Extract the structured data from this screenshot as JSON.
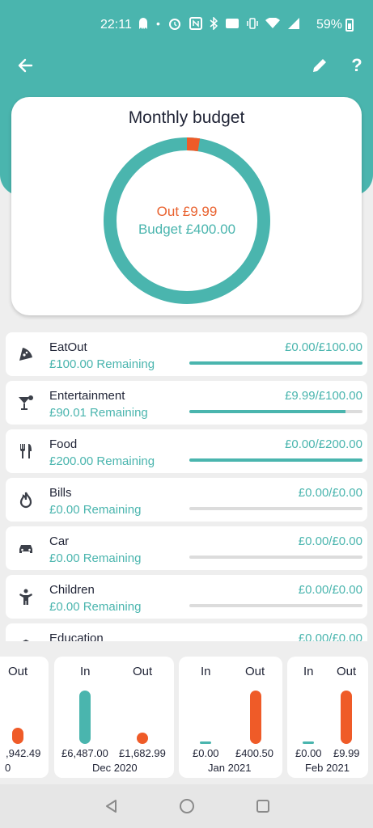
{
  "status_bar": {
    "time": "22:11",
    "dot": "•",
    "battery": "59%",
    "icons": [
      "ghost-icon",
      "alarm-icon",
      "nfc-icon",
      "bluetooth-icon",
      "volte-icon",
      "vibrate-icon",
      "wifi-icon",
      "signal-icon",
      "battery-icon"
    ]
  },
  "toolbar": {
    "back_icon": "arrow-left-icon",
    "edit_icon": "pencil-icon",
    "help_label": "?"
  },
  "budget": {
    "title": "Monthly budget",
    "out_label": "Out £9.99",
    "budget_label": "Budget £400.00",
    "out_value": 9.99,
    "budget_value": 400.0
  },
  "categories": [
    {
      "name": "EatOut",
      "remaining": "£100.00 Remaining",
      "amount": "£0.00/£100.00",
      "icon": "pizza-icon",
      "fill": 1.0
    },
    {
      "name": "Entertainment",
      "remaining": "£90.01 Remaining",
      "amount": "£9.99/£100.00",
      "icon": "cocktail-icon",
      "fill": 0.9
    },
    {
      "name": "Food",
      "remaining": "£200.00 Remaining",
      "amount": "£0.00/£200.00",
      "icon": "cutlery-icon",
      "fill": 1.0
    },
    {
      "name": "Bills",
      "remaining": "£0.00 Remaining",
      "amount": "£0.00/£0.00",
      "icon": "flame-icon",
      "fill": 0
    },
    {
      "name": "Car",
      "remaining": "£0.00 Remaining",
      "amount": "£0.00/£0.00",
      "icon": "car-icon",
      "fill": 0
    },
    {
      "name": "Children",
      "remaining": "£0.00 Remaining",
      "amount": "£0.00/£0.00",
      "icon": "child-icon",
      "fill": 0
    },
    {
      "name": "Education",
      "remaining": "",
      "amount": "£0.00/£0.00",
      "icon": "education-icon",
      "fill": 0
    }
  ],
  "months": [
    {
      "in_label": "",
      "out_label": "Out",
      "in_value": "",
      "out_value": ",942.49",
      "month": "0",
      "in_level": 0,
      "out_level": 0.3
    },
    {
      "in_label": "In",
      "out_label": "Out",
      "in_value": "£6,487.00",
      "out_value": "£1,682.99",
      "month": "Dec 2020",
      "in_level": 1.0,
      "out_level": 0.2
    },
    {
      "in_label": "In",
      "out_label": "Out",
      "in_value": "£0.00",
      "out_value": "£400.50",
      "month": "Jan 2021",
      "in_level": 0,
      "out_level": 1.0
    },
    {
      "in_label": "In",
      "out_label": "Out",
      "in_value": "£0.00",
      "out_value": "£9.99",
      "month": "Feb 2021",
      "in_level": 0,
      "out_level": 1.0
    }
  ],
  "nav": [
    "back-triangle-icon",
    "home-circle-icon",
    "recents-square-icon"
  ],
  "colors": {
    "accent": "#4ab5ae",
    "out": "#ef5b28",
    "background": "#eeeeee"
  }
}
